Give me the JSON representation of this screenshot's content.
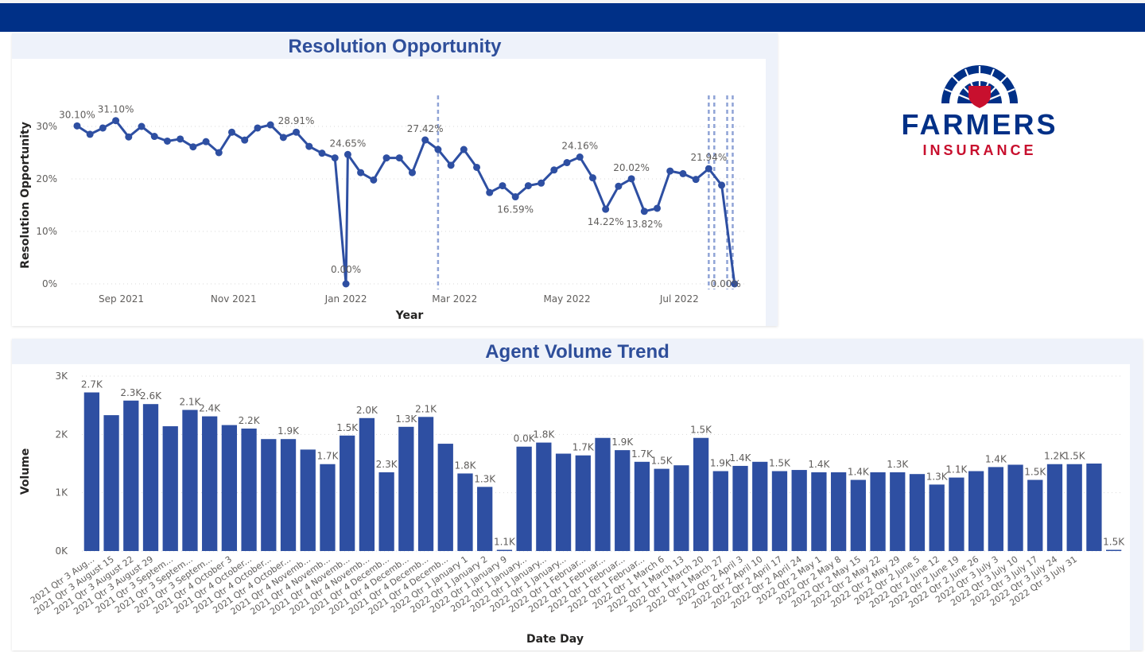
{
  "header": {
    "bar_color": "#003087"
  },
  "logo": {
    "brand": "FARMERS",
    "sub": "INSURANCE",
    "icon": "farmers-crest-icon",
    "colors": {
      "navy": "#003087",
      "red": "#c8102e"
    }
  },
  "colors": {
    "series": "#2e4fa2",
    "title": "#2e4e9a",
    "panel_bg": "#eef2fa"
  },
  "resolution_chart": {
    "title": "Resolution Opportunity",
    "chart_data": {
      "type": "line",
      "title": "Resolution Opportunity",
      "xlabel": "Year",
      "ylabel": "Resolution Opportunity",
      "ylim": [
        0,
        35
      ],
      "y_ticks": [
        0,
        10,
        20,
        30
      ],
      "y_tick_labels": [
        "0%",
        "10%",
        "20%",
        "30%"
      ],
      "x_ticks": [
        {
          "date": "2021-09-01",
          "label": "Sep 2021"
        },
        {
          "date": "2021-11-01",
          "label": "Nov 2021"
        },
        {
          "date": "2022-01-01",
          "label": "Jan 2022"
        },
        {
          "date": "2022-03-01",
          "label": "Mar 2022"
        },
        {
          "date": "2022-05-01",
          "label": "May 2022"
        },
        {
          "date": "2022-07-01",
          "label": "Jul 2022"
        }
      ],
      "xlim": [
        "2021-08-05",
        "2022-08-07"
      ],
      "grid": true,
      "reference_dates": [
        "2022-02-20",
        "2022-07-17",
        "2022-07-20",
        "2022-07-27",
        "2022-07-30"
      ],
      "points": [
        {
          "x": "2021-08-08",
          "y": 30.1,
          "label": "30.10%"
        },
        {
          "x": "2021-08-15",
          "y": 28.5
        },
        {
          "x": "2021-08-22",
          "y": 29.7
        },
        {
          "x": "2021-08-29",
          "y": 31.1,
          "label": "31.10%"
        },
        {
          "x": "2021-09-05",
          "y": 28.0
        },
        {
          "x": "2021-09-12",
          "y": 30.0
        },
        {
          "x": "2021-09-19",
          "y": 28.1
        },
        {
          "x": "2021-09-26",
          "y": 27.2
        },
        {
          "x": "2021-10-03",
          "y": 27.6
        },
        {
          "x": "2021-10-10",
          "y": 26.1
        },
        {
          "x": "2021-10-17",
          "y": 27.1
        },
        {
          "x": "2021-10-24",
          "y": 25.0
        },
        {
          "x": "2021-10-31",
          "y": 28.9
        },
        {
          "x": "2021-11-07",
          "y": 27.4
        },
        {
          "x": "2021-11-14",
          "y": 29.7
        },
        {
          "x": "2021-11-21",
          "y": 30.3
        },
        {
          "x": "2021-11-28",
          "y": 27.9
        },
        {
          "x": "2021-12-05",
          "y": 28.91,
          "label": "28.91%"
        },
        {
          "x": "2021-12-12",
          "y": 26.2
        },
        {
          "x": "2021-12-19",
          "y": 24.9
        },
        {
          "x": "2021-12-26",
          "y": 24.0
        },
        {
          "x": "2022-01-01",
          "y": 0.0,
          "label": "0.00%"
        },
        {
          "x": "2022-01-02",
          "y": 24.65,
          "label": "24.65%"
        },
        {
          "x": "2022-01-09",
          "y": 21.2
        },
        {
          "x": "2022-01-16",
          "y": 19.8
        },
        {
          "x": "2022-01-23",
          "y": 24.0
        },
        {
          "x": "2022-01-30",
          "y": 24.0
        },
        {
          "x": "2022-02-06",
          "y": 21.2
        },
        {
          "x": "2022-02-13",
          "y": 27.42,
          "label": "27.42%"
        },
        {
          "x": "2022-02-20",
          "y": 25.6
        },
        {
          "x": "2022-02-27",
          "y": 22.6
        },
        {
          "x": "2022-03-06",
          "y": 25.6
        },
        {
          "x": "2022-03-13",
          "y": 22.2
        },
        {
          "x": "2022-03-20",
          "y": 17.4
        },
        {
          "x": "2022-03-27",
          "y": 18.7
        },
        {
          "x": "2022-04-03",
          "y": 16.59,
          "label": "16.59%"
        },
        {
          "x": "2022-04-10",
          "y": 18.7
        },
        {
          "x": "2022-04-17",
          "y": 19.2
        },
        {
          "x": "2022-04-24",
          "y": 21.7
        },
        {
          "x": "2022-05-01",
          "y": 23.1
        },
        {
          "x": "2022-05-08",
          "y": 24.16,
          "label": "24.16%"
        },
        {
          "x": "2022-05-15",
          "y": 20.2
        },
        {
          "x": "2022-05-22",
          "y": 14.22,
          "label": "14.22%"
        },
        {
          "x": "2022-05-29",
          "y": 18.6
        },
        {
          "x": "2022-06-05",
          "y": 20.02,
          "label": "20.02%"
        },
        {
          "x": "2022-06-12",
          "y": 13.82,
          "label": "13.82%"
        },
        {
          "x": "2022-06-19",
          "y": 14.4
        },
        {
          "x": "2022-06-26",
          "y": 21.5
        },
        {
          "x": "2022-07-03",
          "y": 21.0
        },
        {
          "x": "2022-07-10",
          "y": 19.9
        },
        {
          "x": "2022-07-17",
          "y": 21.94,
          "label": "21.94%"
        },
        {
          "x": "2022-07-24",
          "y": 18.8
        },
        {
          "x": "2022-07-31",
          "y": 0.0,
          "label": "0.00%"
        }
      ]
    }
  },
  "volume_chart": {
    "title": "Agent Volume Trend",
    "chart_data": {
      "type": "bar",
      "title": "Agent Volume Trend",
      "xlabel": "Date Day",
      "ylabel": "Volume",
      "ylim": [
        0,
        3000
      ],
      "y_ticks": [
        0,
        1000,
        2000,
        3000
      ],
      "y_tick_labels": [
        "0K",
        "1K",
        "2K",
        "3K"
      ],
      "grid": true,
      "categories": [
        "2021 Qtr 3 Aug...",
        "2021 Qtr 3 August 15",
        "2021 Qtr 3 August 22",
        "2021 Qtr 3 August 29",
        "2021 Qtr 3 Septem...",
        "2021 Qtr 3 Septem...",
        "2021 Qtr 3 Septem...",
        "2021 Qtr 4 October 3",
        "2021 Qtr 4 October...",
        "2021 Qtr 4 October...",
        "2021 Qtr 4 October...",
        "2021 Qtr 4 Novemb...",
        "2021 Qtr 4 Novemb...",
        "2021 Qtr 4 Novemb...",
        "2021 Qtr 4 Novemb...",
        "2021 Qtr 4 Decemb...",
        "2021 Qtr 4 Decemb...",
        "2021 Qtr 4 Decemb...",
        "2021 Qtr 4 Decemb...",
        "2022 Qtr 1 January 1",
        "2022 Qtr 1 January 2",
        "2022 Qtr 1 January 9",
        "2022 Qtr 1 January...",
        "2022 Qtr 1 January...",
        "2022 Qtr 1 January...",
        "2022 Qtr 1 Februar...",
        "2022 Qtr 1 Februar...",
        "2022 Qtr 1 Februar...",
        "2022 Qtr 1 Februar...",
        "2022 Qtr 1 March 6",
        "2022 Qtr 1 March 13",
        "2022 Qtr 1 March 20",
        "2022 Qtr 1 March 27",
        "2022 Qtr 2 April 3",
        "2022 Qtr 2 April 10",
        "2022 Qtr 2 April 17",
        "2022 Qtr 2 April 24",
        "2022 Qtr 2 May 1",
        "2022 Qtr 2 May 8",
        "2022 Qtr 2 May 15",
        "2022 Qtr 2 May 22",
        "2022 Qtr 2 May 29",
        "2022 Qtr 2 June 5",
        "2022 Qtr 2 June 12",
        "2022 Qtr 2 June 19",
        "2022 Qtr 2 June 26",
        "2022 Qtr 3 July 3",
        "2022 Qtr 3 July 10",
        "2022 Qtr 3 July 17",
        "2022 Qtr 3 July 24",
        "2022 Qtr 3 July 31"
      ],
      "values": [
        2720,
        2330,
        2580,
        2520,
        2140,
        2420,
        2310,
        2160,
        2100,
        1920,
        1920,
        1740,
        1490,
        1980,
        2280,
        1350,
        2130,
        2300,
        1840,
        1330,
        1100,
        20,
        1790,
        1860,
        1670,
        1640,
        1940,
        1730,
        1530,
        1410,
        1470,
        1940,
        1370,
        1460,
        1530,
        1370,
        1390,
        1350,
        1350,
        1220,
        1350,
        1350,
        1320,
        1140,
        1260,
        1370,
        1440,
        1480,
        1220,
        1490,
        1490,
        1500,
        20
      ],
      "value_labels": [
        "2.7K",
        "",
        "2.3K",
        "2.6K",
        "",
        "2.1K",
        "2.4K",
        "",
        "2.2K",
        "",
        "1.9K",
        "",
        "1.7K",
        "1.5K",
        "2.0K",
        "2.3K",
        "1.3K",
        "2.1K",
        "",
        "1.8K",
        "1.3K",
        "1.1K",
        "0.0K",
        "1.8K",
        "",
        "1.7K",
        "",
        "1.9K",
        "1.7K",
        "1.5K",
        "",
        "1.5K",
        "1.9K",
        "1.4K",
        "",
        "1.5K",
        "",
        "1.4K",
        "",
        "1.4K",
        "",
        "1.3K",
        "",
        "1.3K",
        "1.1K",
        "",
        "1.4K",
        "",
        "1.5K",
        "1.2K",
        "1.5K",
        "",
        "1.5K",
        "0.0K"
      ]
    }
  }
}
